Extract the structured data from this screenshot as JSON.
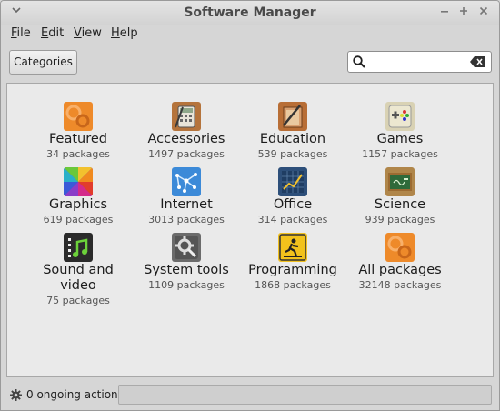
{
  "window": {
    "title": "Software Manager"
  },
  "menubar": [
    {
      "label": "File",
      "key": "F",
      "rest": "ile"
    },
    {
      "label": "Edit",
      "key": "E",
      "rest": "dit"
    },
    {
      "label": "View",
      "key": "V",
      "rest": "iew"
    },
    {
      "label": "Help",
      "key": "H",
      "rest": "elp"
    }
  ],
  "toolbar": {
    "categories_label": "Categories",
    "search_value": "",
    "search_placeholder": ""
  },
  "categories": [
    {
      "name": "Featured",
      "count": "34 packages",
      "icon": "featured-icon"
    },
    {
      "name": "Accessories",
      "count": "1497 packages",
      "icon": "accessories-icon"
    },
    {
      "name": "Education",
      "count": "539 packages",
      "icon": "education-icon"
    },
    {
      "name": "Games",
      "count": "1157 packages",
      "icon": "games-icon"
    },
    {
      "name": "Graphics",
      "count": "619 packages",
      "icon": "graphics-icon"
    },
    {
      "name": "Internet",
      "count": "3013 packages",
      "icon": "internet-icon"
    },
    {
      "name": "Office",
      "count": "314 packages",
      "icon": "office-icon"
    },
    {
      "name": "Science",
      "count": "939 packages",
      "icon": "science-icon"
    },
    {
      "name": "Sound and video",
      "count": "75 packages",
      "icon": "sound-video-icon"
    },
    {
      "name": "System tools",
      "count": "1109 packages",
      "icon": "system-tools-icon"
    },
    {
      "name": "Programming",
      "count": "1868 packages",
      "icon": "programming-icon"
    },
    {
      "name": "All packages",
      "count": "32148 packages",
      "icon": "all-packages-icon"
    }
  ],
  "status": {
    "text": "0 ongoing actions",
    "progress": 0
  }
}
